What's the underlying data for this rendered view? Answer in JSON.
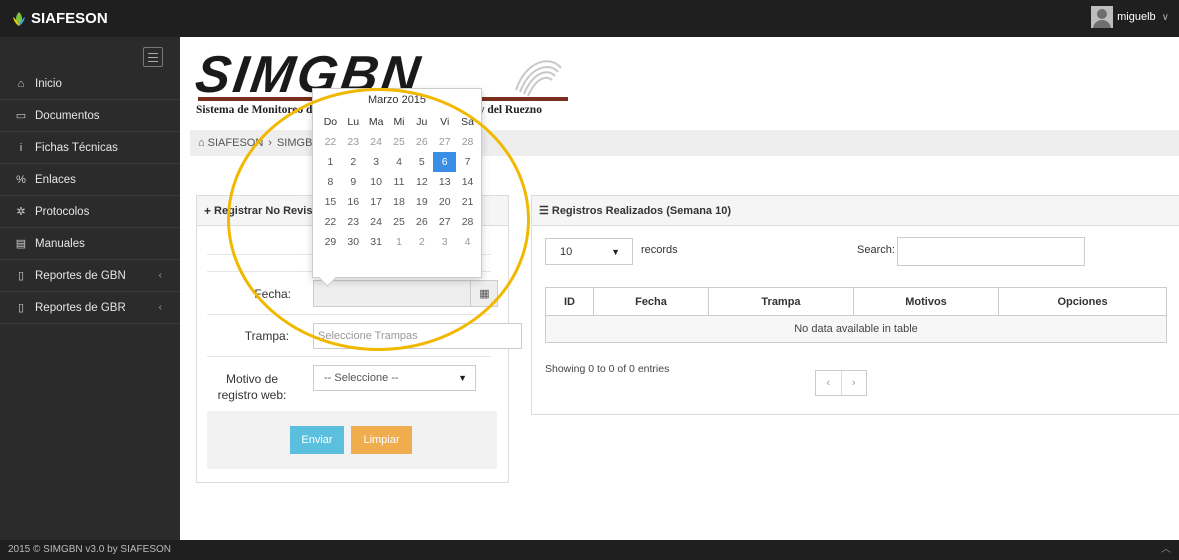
{
  "app": {
    "brand": "SIAFESON"
  },
  "user": {
    "name": "miguelb"
  },
  "sidebar": {
    "items": [
      {
        "label": "Inicio",
        "icon": "home-icon",
        "glyph": "⌂",
        "arrow": ""
      },
      {
        "label": "Documentos",
        "icon": "folder-icon",
        "glyph": "▭",
        "arrow": ""
      },
      {
        "label": "Fichas Técnicas",
        "icon": "info-icon",
        "glyph": "i",
        "arrow": ""
      },
      {
        "label": "Enlaces",
        "icon": "link-icon",
        "glyph": "%",
        "arrow": ""
      },
      {
        "label": "Protocolos",
        "icon": "gear-icon",
        "glyph": "✲",
        "arrow": ""
      },
      {
        "label": "Manuales",
        "icon": "book-icon",
        "glyph": "▤",
        "arrow": ""
      },
      {
        "label": "Reportes de GBN",
        "icon": "file-icon",
        "glyph": "▯",
        "arrow": "‹"
      },
      {
        "label": "Reportes de GBR",
        "icon": "file-icon",
        "glyph": "▯",
        "arrow": "‹"
      }
    ]
  },
  "logo": {
    "title": "SIMGBN",
    "subtitle": "Sistema de Monitoreo del Gusano Barrenador de la Nuez y del Ruezno"
  },
  "breadcrumb": {
    "home": "SIAFESON",
    "sep": "›",
    "current": "SIMGBN"
  },
  "form": {
    "title": "Registrar No Revisión",
    "fecha_label": "Fecha:",
    "trampa_label": "Trampa:",
    "trampa_placeholder": "Seleccione Trampas",
    "motivo_label_1": "Motivo de",
    "motivo_label_2": "registro web:",
    "motivo_value": "-- Seleccione --",
    "send_label": "Enviar",
    "clear_label": "Limpiar"
  },
  "datepicker": {
    "title": "Marzo 2015",
    "dow": [
      "Do",
      "Lu",
      "Ma",
      "Mi",
      "Ju",
      "Vi",
      "Sa"
    ],
    "days": [
      "22",
      "23",
      "24",
      "25",
      "26",
      "27",
      "28",
      "1",
      "2",
      "3",
      "4",
      "5",
      "6",
      "7",
      "8",
      "9",
      "10",
      "11",
      "12",
      "13",
      "14",
      "15",
      "16",
      "17",
      "18",
      "19",
      "20",
      "21",
      "22",
      "23",
      "24",
      "25",
      "26",
      "27",
      "28",
      "29",
      "30",
      "31",
      "1",
      "2",
      "3",
      "4"
    ],
    "selected_index": 12,
    "current_month_range": [
      7,
      37
    ]
  },
  "records": {
    "title": "Registros Realizados (Semana 10)",
    "length_value": "10",
    "length_label": "records",
    "search_label": "Search:",
    "columns": [
      "ID",
      "Fecha",
      "Trampa",
      "Motivos",
      "Opciones"
    ],
    "empty_message": "No data available in table",
    "info": "Showing 0 to 0 of 0 entries",
    "prev": "‹",
    "next": "›"
  },
  "footer": {
    "text": "2015 © SIMGBN v3.0 by SIAFESON"
  },
  "colors": {
    "accent_blue": "#3a8ee6",
    "info_button": "#5bc0de",
    "warning_button": "#f0ad4e",
    "annotation_ring": "#f2b800"
  }
}
